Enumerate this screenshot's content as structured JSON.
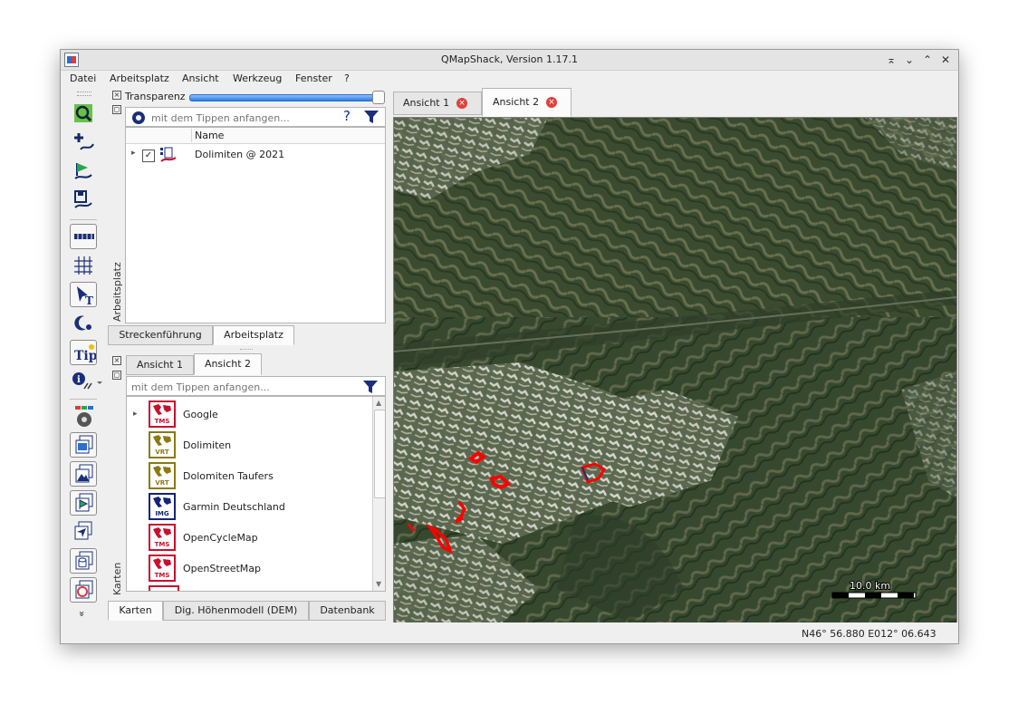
{
  "window": {
    "title": "QMapShack, Version 1.17.1"
  },
  "window_controls": [
    "⌅",
    "⌄",
    "⌃",
    "✕"
  ],
  "menu": [
    "Datei",
    "Arbeitsplatz",
    "Ansicht",
    "Werkzeug",
    "Fenster",
    "?"
  ],
  "toolbar": {
    "tools": [
      "search-icon",
      "add-waypoint-icon",
      "add-route-icon",
      "save-track-icon",
      "ruler-icon",
      "grid-icon",
      "text-tool-icon",
      "night-mode-icon",
      "tip-icon",
      "info-icon",
      "map-setup-icon",
      "map-view-icon",
      "dem-view-icon",
      "workspace-view-icon",
      "route-view-icon",
      "database-view-icon",
      "gis-view-icon"
    ],
    "tip_label": "Tip",
    "more_label": "»"
  },
  "workspace_dock": {
    "vertical_label": "Arbeitsplatz",
    "transparency_label": "Transparenz",
    "transparency_value": 100,
    "search_placeholder": "mit dem Tippen anfangen...",
    "help_label": "?",
    "column_name": "Name",
    "items": [
      {
        "label": "Dolimiten @ 2021",
        "checked": "✓"
      }
    ],
    "tabs": [
      {
        "label": "Streckenführung"
      },
      {
        "label": "Arbeitsplatz",
        "active": true
      }
    ]
  },
  "maps_dock": {
    "vertical_label": "Karten",
    "view_tabs": [
      {
        "label": "Ansicht 1"
      },
      {
        "label": "Ansicht 2",
        "active": true
      }
    ],
    "search_placeholder": "mit dem Tippen anfangen...",
    "maps": [
      {
        "label": "Google",
        "type": "TMS",
        "color": "#c8102e"
      },
      {
        "label": "Dolimiten",
        "type": "VRT",
        "color": "#8a7a10"
      },
      {
        "label": "Dolomiten Taufers",
        "type": "VRT",
        "color": "#8a7a10"
      },
      {
        "label": "Garmin Deutschland",
        "type": "IMG",
        "color": "#15237a"
      },
      {
        "label": "OpenCycleMap",
        "type": "TMS",
        "color": "#c8102e"
      },
      {
        "label": "OpenStreetMap",
        "type": "TMS",
        "color": "#c8102e"
      }
    ],
    "bottom_tabs": [
      {
        "label": "Karten",
        "active": true
      },
      {
        "label": "Dig. Höhenmodell (DEM)"
      },
      {
        "label": "Datenbank"
      }
    ]
  },
  "map_tabs": [
    {
      "label": "Ansicht 1"
    },
    {
      "label": "Ansicht 2",
      "active": true
    }
  ],
  "map": {
    "scale_label": "10.0 km"
  },
  "status": {
    "coordinates": "N46° 56.880 E012° 06.643"
  },
  "colors": {
    "accent": "#2f7de0",
    "track": "#ff0000",
    "close_badge": "#e0413b"
  }
}
